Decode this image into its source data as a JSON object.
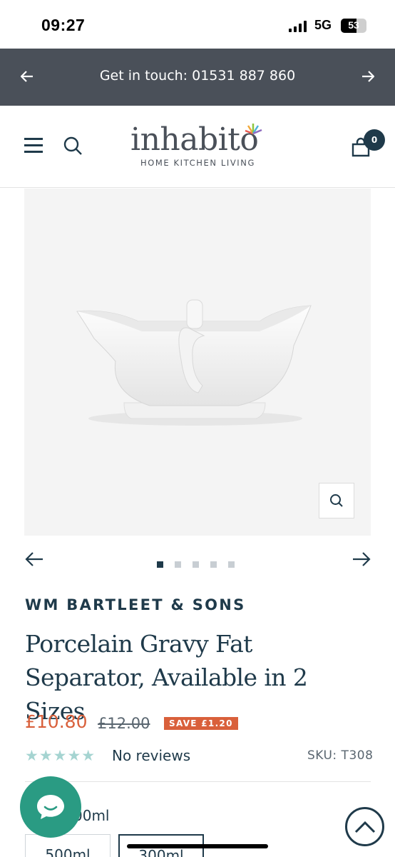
{
  "status_bar": {
    "time": "09:27",
    "network": "5G",
    "battery": "53"
  },
  "announcement": {
    "text": "Get in touch: 01531 887 860",
    "prev_icon": "arrow-left-icon",
    "next_icon": "arrow-right-icon"
  },
  "header": {
    "logo_text": "inhabito",
    "logo_tagline": "HOME KITCHEN LIVING",
    "cart_count": "0"
  },
  "gallery": {
    "image_count": 5,
    "active_index": 0
  },
  "product": {
    "brand": "WM BARTLEET & SONS",
    "title": "Porcelain Gravy Fat Separator, Available in 2 Sizes",
    "price": "£10.80",
    "compare_price": "£12.00",
    "save_badge": "SAVE £1.20",
    "stars": "★★★★★",
    "rating_out_of_5": 0,
    "reviews": "No reviews",
    "sku": "SKU: T308"
  },
  "size": {
    "label_visible": "00ml",
    "options": [
      "500ml",
      "300ml"
    ],
    "selected_index": 1
  },
  "colors": {
    "announcement_bg": "#4a5059",
    "primary_text": "#1f3a4a",
    "sale": "#d9603b",
    "star": "#a5d4d1",
    "chat": "#2a9b83"
  }
}
